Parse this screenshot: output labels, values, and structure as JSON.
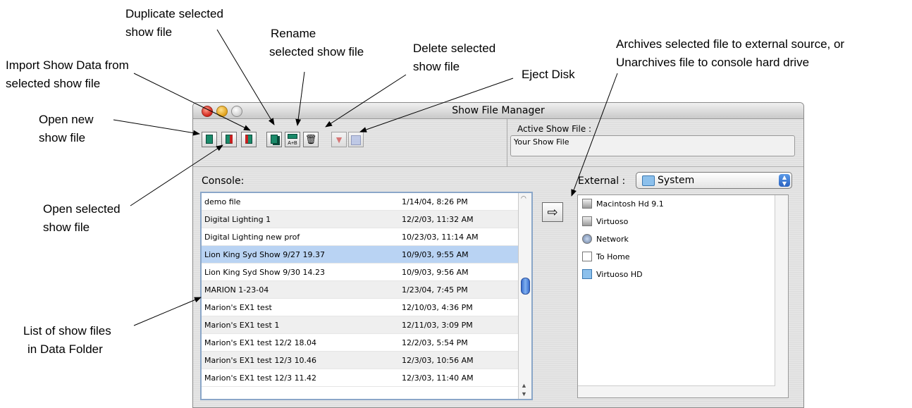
{
  "callouts": {
    "duplicate": [
      "Duplicate selected",
      "show file"
    ],
    "rename": [
      "Rename",
      "selected show file"
    ],
    "delete": [
      "Delete selected",
      "show file"
    ],
    "eject": "Eject Disk",
    "archives": [
      "Archives selected file to external source, or",
      "Unarchives file to console hard drive"
    ],
    "import": [
      "Import Show Data from",
      "selected show file"
    ],
    "open_new": [
      "Open new",
      "show file"
    ],
    "open_selected": [
      "Open selected",
      "show file"
    ],
    "list": [
      "List of show files",
      "in Data Folder"
    ]
  },
  "window": {
    "title": "Show File Manager",
    "active_label": "Active Show File :",
    "active_value": "Your Show File",
    "console_label": "Console:",
    "external_label": "External :",
    "external_selected": "System",
    "move_glyph": "⇨"
  },
  "toolbar": {
    "icons": [
      "open-new-icon",
      "open-selected-icon",
      "import-icon",
      "duplicate-icon",
      "rename-icon",
      "delete-icon",
      "eject-icon",
      "eject-disk-icon"
    ],
    "rename_glyph": "A+B",
    "delete_glyph": "🗑"
  },
  "console_files": [
    {
      "name": "demo file",
      "date": "1/14/04, 8:26 PM"
    },
    {
      "name": "Digital Lighting 1",
      "date": "12/2/03, 11:32 AM"
    },
    {
      "name": "Digital Lighting new prof",
      "date": "10/23/03, 11:14 AM"
    },
    {
      "name": "Lion King Syd Show 9/27 19.37",
      "date": "10/9/03, 9:55 AM",
      "selected": true
    },
    {
      "name": "Lion King Syd Show 9/30 14.23",
      "date": "10/9/03, 9:56 AM"
    },
    {
      "name": "MARION 1-23-04",
      "date": "1/23/04, 7:45 PM"
    },
    {
      "name": "Marion's EX1 test",
      "date": "12/10/03, 4:36 PM"
    },
    {
      "name": "Marion's EX1 test 1",
      "date": "12/11/03, 3:09 PM"
    },
    {
      "name": "Marion's EX1 test 12/2 18.04",
      "date": "12/2/03, 5:54 PM"
    },
    {
      "name": "Marion's EX1 test 12/3 10.46",
      "date": "12/3/03, 10:56 AM"
    },
    {
      "name": "Marion's EX1 test 12/3 11.42",
      "date": "12/3/03, 11:40 AM"
    }
  ],
  "external_items": [
    {
      "label": "Macintosh Hd 9.1",
      "icon": "disk"
    },
    {
      "label": "Virtuoso",
      "icon": "disk"
    },
    {
      "label": "Network",
      "icon": "net"
    },
    {
      "label": "To Home",
      "icon": "doc"
    },
    {
      "label": "Virtuoso HD",
      "icon": "fold"
    }
  ]
}
